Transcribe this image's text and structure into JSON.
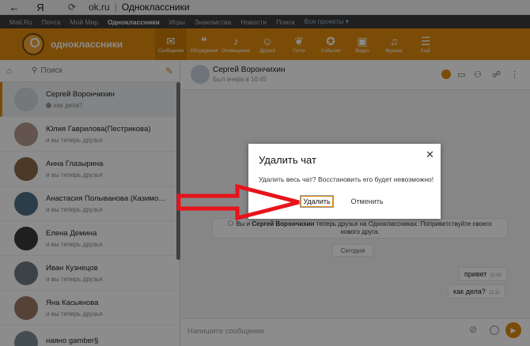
{
  "browser": {
    "back_icon": "arrow-left-icon",
    "yandex_label": "Я",
    "reload_icon": "reload-icon",
    "url": "ok.ru",
    "page_title": "Одноклассники"
  },
  "portal": {
    "items": [
      "Mail.Ru",
      "Почта",
      "Мой Мир",
      "Одноклассники",
      "Игры",
      "Знакомства",
      "Новости",
      "Поиск",
      "Все проекты ▾"
    ]
  },
  "ok_header": {
    "logo_text": "одноклассники",
    "nav": [
      {
        "label": "Сообщения",
        "icon": "envelope-icon",
        "glyph": "✉"
      },
      {
        "label": "Обсуждения",
        "icon": "chat-bubbles-icon",
        "glyph": "❝"
      },
      {
        "label": "Оповещения",
        "icon": "bell-icon",
        "glyph": "♪"
      },
      {
        "label": "Друзья",
        "icon": "friends-icon",
        "glyph": "☺"
      },
      {
        "label": "Гости",
        "icon": "footprints-icon",
        "glyph": "❦"
      },
      {
        "label": "События",
        "icon": "events-icon",
        "glyph": "✪"
      },
      {
        "label": "Видео",
        "icon": "video-icon",
        "glyph": "▣"
      },
      {
        "label": "Музыка",
        "icon": "music-icon",
        "glyph": "♫"
      },
      {
        "label": "Ещё",
        "icon": "menu-icon",
        "glyph": "☰"
      }
    ]
  },
  "sidebar": {
    "search_placeholder": "Поиск",
    "contacts": [
      {
        "name": "Сергей Ворончихин",
        "msg": "как дела?",
        "avatar_color": "#d5dade"
      },
      {
        "name": "Юлия Гаврилова(Пестрикова)",
        "msg": "и вы теперь друзья",
        "avatar_color": "#b79a8e"
      },
      {
        "name": "Анна Глазырина",
        "msg": "и вы теперь друзья",
        "avatar_color": "#8a6a4c"
      },
      {
        "name": "Анастасия Полыванова (Казимо…",
        "msg": "и вы теперь друзья",
        "avatar_color": "#4f6f86"
      },
      {
        "name": "Елена Демина",
        "msg": "и вы теперь друзья",
        "avatar_color": "#3a3a3a"
      },
      {
        "name": "Иван Кузнецов",
        "msg": "и вы теперь друзья",
        "avatar_color": "#6d7a80"
      },
      {
        "name": "Яна Касьянова",
        "msg": "и вы теперь друзья",
        "avatar_color": "#9c7b6a"
      },
      {
        "name": "наяно gamber§",
        "msg": "",
        "avatar_color": "#7a8c96"
      }
    ]
  },
  "chat": {
    "name": "Сергей Ворончихин",
    "status": "Был вчера в 10:45",
    "system_line1_pre": "Вы и ",
    "system_name": "Сергей Ворончихин",
    "system_line1_post": " теперь друзья на Одноклассниках. Поприветствуйте своего",
    "system_line2": "нового друга.",
    "day_label": "Сегодня",
    "messages": [
      {
        "text": "привет",
        "time": "11:00"
      },
      {
        "text": "как дела?",
        "time": "11:11"
      }
    ],
    "input_placeholder": "Напишите сообщение"
  },
  "dialog": {
    "title": "Удалить чат",
    "close_glyph": "✕",
    "text": "Удалить весь чат? Восстановить его будет невозможно!",
    "confirm_label": "Удалить",
    "cancel_label": "Отменить"
  },
  "accent_color": "#e08a10",
  "arrow_color": "#e8131b"
}
